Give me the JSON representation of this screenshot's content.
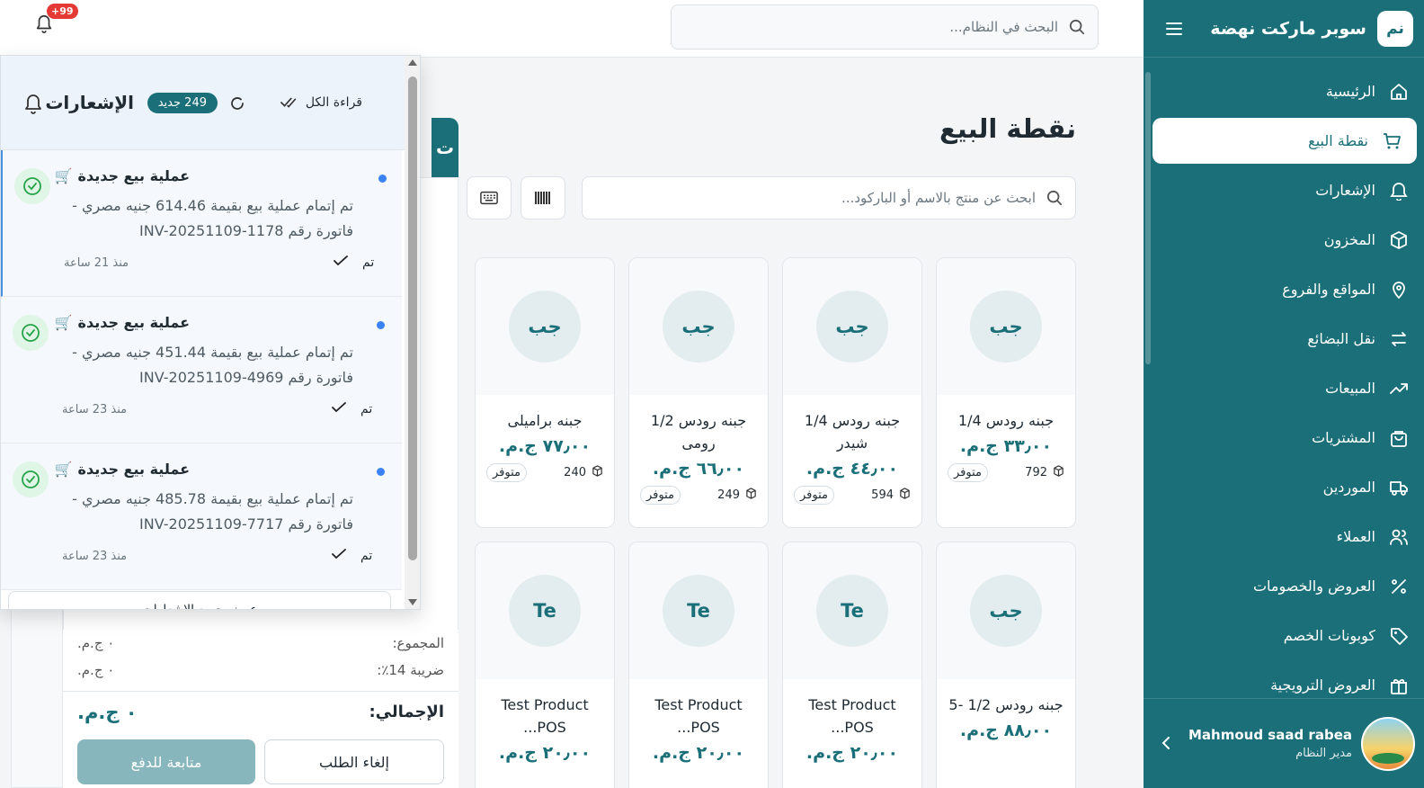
{
  "sidebar": {
    "logo_text": "نم",
    "brand": "سوبر ماركت نهضة",
    "items": [
      {
        "label": "الرئيسية",
        "icon": "home-icon"
      },
      {
        "label": "نقطة البيع",
        "icon": "cart-icon",
        "active": true
      },
      {
        "label": "الإشعارات",
        "icon": "bell-icon"
      },
      {
        "label": "المخزون",
        "icon": "box-icon"
      },
      {
        "label": "المواقع والفروع",
        "icon": "map-pin-icon"
      },
      {
        "label": "نقل البضائع",
        "icon": "transfer-icon"
      },
      {
        "label": "المبيعات",
        "icon": "trend-up-icon"
      },
      {
        "label": "المشتريات",
        "icon": "bag-icon"
      },
      {
        "label": "الموردين",
        "icon": "truck-icon"
      },
      {
        "label": "العملاء",
        "icon": "users-icon"
      },
      {
        "label": "العروض والخصومات",
        "icon": "percent-icon"
      },
      {
        "label": "كوبونات الخصم",
        "icon": "tag-icon"
      },
      {
        "label": "العروض الترويجية",
        "icon": "gift-icon"
      }
    ],
    "user": {
      "name": "Mahmoud saad rabea",
      "role": "مدير النظام"
    }
  },
  "topbar": {
    "search_placeholder": "البحث في النظام...",
    "notif_badge": "+99"
  },
  "pos": {
    "title": "نقطة البيع",
    "search_placeholder": "ابحث عن منتج بالاسم أو الباركود...",
    "cart_tab_label": "ت",
    "products": [
      {
        "initials": "جب",
        "name": "جبنه رودس 1/4",
        "price": "٣٣٫٠٠ ج.م.",
        "stock": "792",
        "status": "متوفر"
      },
      {
        "initials": "جب",
        "name": "جبنه رودس 1/4 شيدر",
        "price": "٤٤٫٠٠ ج.م.",
        "stock": "594",
        "status": "متوفر"
      },
      {
        "initials": "جب",
        "name": "جبنه رودس 1/2 رومى",
        "price": "٦٦٫٠٠ ج.م.",
        "stock": "249",
        "status": "متوفر"
      },
      {
        "initials": "جب",
        "name": "جبنه براميلى",
        "price": "٧٧٫٠٠ ج.م.",
        "stock": "240",
        "status": "متوفر"
      },
      {
        "initials": "جب",
        "name": "جبنه رودس 1/2 -5",
        "price": "٨٨٫٠٠ ج.م.",
        "stock": "",
        "status": ""
      },
      {
        "initials": "Te",
        "name": "Test Product POS...",
        "price": "٢٠٫٠٠ ج.م.",
        "stock": "",
        "status": ""
      },
      {
        "initials": "Te",
        "name": "Test Product POS...",
        "price": "٢٠٫٠٠ ج.م.",
        "stock": "",
        "status": ""
      },
      {
        "initials": "Te",
        "name": "Test Product POS...",
        "price": "٢٠٫٠٠ ج.م.",
        "stock": "",
        "status": ""
      }
    ],
    "totals": {
      "subtotal_label": "المجموع:",
      "subtotal_value": "٠ ج.م.",
      "tax_label": "ضريبة 14٪:",
      "tax_value": "٠ ج.م.",
      "total_label": "الإجمالي:",
      "total_value": "٠ ج.م."
    },
    "cancel_label": "إلغاء الطلب",
    "pay_label": "متابعة للدفع"
  },
  "notifications": {
    "title": "الإشعارات",
    "new_badge": "249 جديد",
    "read_all": "قراءة الكل",
    "footer": "عرض جميع الإشعارات",
    "items": [
      {
        "title": "عملية بيع جديدة",
        "emoji": "🛒",
        "message": "تم إتمام عملية بيع بقيمة 614.46 جنيه مصري - فاتورة رقم INV-20251109-1178",
        "status": "تم",
        "time": "منذ 21 ساعة"
      },
      {
        "title": "عملية بيع جديدة",
        "emoji": "🛒",
        "message": "تم إتمام عملية بيع بقيمة 451.44 جنيه مصري - فاتورة رقم INV-20251109-4969",
        "status": "تم",
        "time": "منذ 23 ساعة"
      },
      {
        "title": "عملية بيع جديدة",
        "emoji": "🛒",
        "message": "تم إتمام عملية بيع بقيمة 485.78 جنيه مصري - فاتورة رقم INV-20251109-7717",
        "status": "تم",
        "time": "منذ 23 ساعة"
      }
    ]
  }
}
